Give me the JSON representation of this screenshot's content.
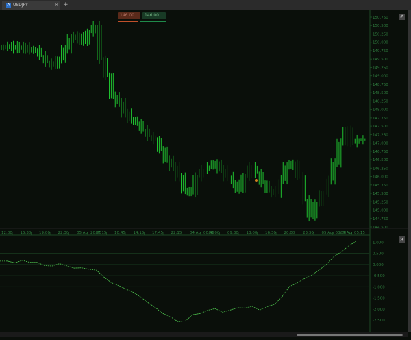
{
  "tab": {
    "label": "USDJPY",
    "icon": "chart-icon"
  },
  "trade": {
    "sell_price": "146.00",
    "buy_price": "146.00",
    "sell_color": "#c0502a",
    "buy_color": "#1f8a4a"
  },
  "colors": {
    "bars": "#1fc02f",
    "indicator": "#4fc84f",
    "axis_text": "#2f7f3f"
  },
  "chart_data": [
    {
      "type": "bar",
      "name": "price",
      "yticks": [
        "150.750",
        "150.500",
        "150.250",
        "150.000",
        "149.750",
        "149.500",
        "149.250",
        "149.000",
        "148.750",
        "148.500",
        "148.250",
        "148.000",
        "147.750",
        "147.500",
        "147.250",
        "147.000",
        "146.750",
        "146.500",
        "146.250",
        "146.000",
        "145.750",
        "145.500",
        "145.250",
        "145.000",
        "144.750",
        "144.500"
      ],
      "ylim": [
        144.5,
        150.75
      ],
      "xticks": [
        "12:00",
        "15:30",
        "19:00",
        "22:30",
        "05 Apr 20:00",
        "07:15",
        "10:45",
        "14:15",
        "17:45",
        "22:15",
        "04 Apr 00:45",
        "06:00",
        "09:30",
        "13:00",
        "16:30",
        "20:00",
        "23:30",
        "05 Apr 03:00",
        "07 Apr 05:15"
      ],
      "closes": [
        149.85,
        149.9,
        149.8,
        149.88,
        149.75,
        149.8,
        149.6,
        149.4,
        149.3,
        149.5,
        149.8,
        150.1,
        150.2,
        150.0,
        150.3,
        150.5,
        149.5,
        149.0,
        148.4,
        148.2,
        147.9,
        147.7,
        147.6,
        147.4,
        147.2,
        147.1,
        146.8,
        146.5,
        146.3,
        146.0,
        145.6,
        145.5,
        146.0,
        146.2,
        146.3,
        146.4,
        146.2,
        146.0,
        145.8,
        145.6,
        146.0,
        146.3,
        146.1,
        145.8,
        145.6,
        145.5,
        145.9,
        146.3,
        146.4,
        146.0,
        145.3,
        144.8,
        145.2,
        145.5,
        145.9,
        146.4,
        147.0,
        147.4,
        147.0,
        147.1,
        147.1
      ]
    },
    {
      "type": "line",
      "name": "indicator",
      "yticks": [
        "1.000",
        "0.500",
        "0.000",
        "-0.500",
        "-1.000",
        "-1.500",
        "-2.000",
        "-2.500"
      ],
      "ylim": [
        -2.8,
        1.1
      ],
      "values": [
        0.15,
        0.2,
        0.1,
        0.15,
        0.05,
        0.1,
        0.0,
        -0.05,
        0.0,
        -0.1,
        -0.15,
        -0.1,
        -0.2,
        -0.3,
        -0.6,
        -0.8,
        -0.9,
        -1.1,
        -1.3,
        -1.5,
        -1.7,
        -1.9,
        -2.2,
        -2.4,
        -2.6,
        -2.5,
        -2.2,
        -2.2,
        -2.1,
        -2.0,
        -2.1,
        -2.0,
        -1.95,
        -2.0,
        -1.9,
        -2.0,
        -1.85,
        -1.8,
        -1.5,
        -1.0,
        -0.8,
        -0.6,
        -0.5,
        -0.3,
        0.0,
        0.4,
        0.6,
        0.8,
        1.0
      ]
    }
  ]
}
